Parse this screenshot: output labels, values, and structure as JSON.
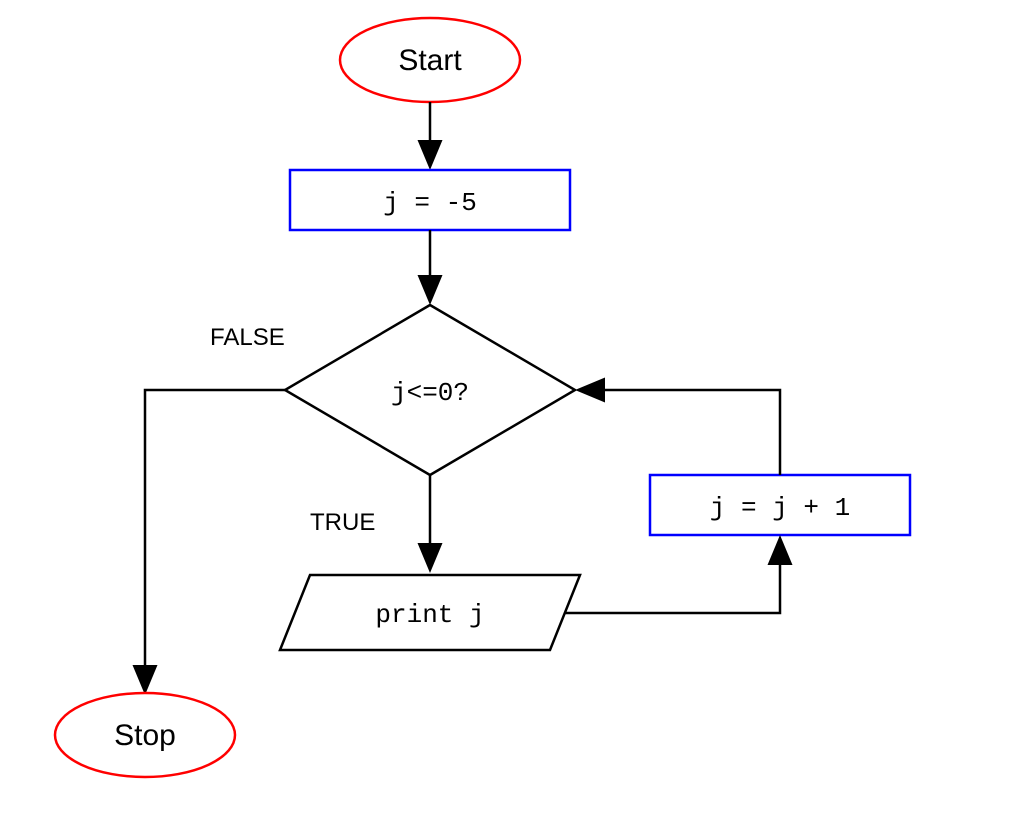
{
  "flowchart": {
    "start": "Start",
    "stop": "Stop",
    "init": "j = -5",
    "condition": "j<=0?",
    "false_label": "FALSE",
    "true_label": "TRUE",
    "print": "print j",
    "increment": "j = j + 1"
  }
}
